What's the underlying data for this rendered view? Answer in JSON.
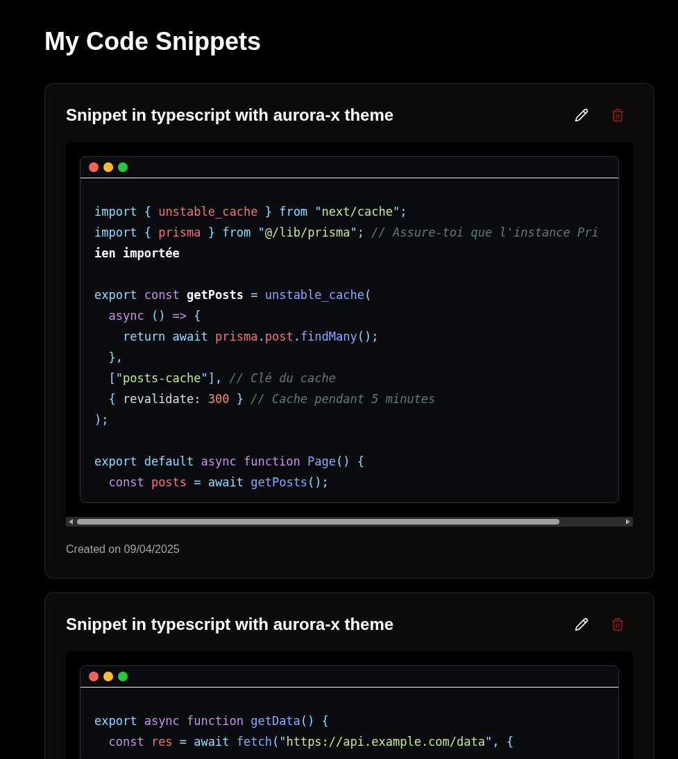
{
  "page": {
    "title": "My Code Snippets"
  },
  "snippets": [
    {
      "title": "Snippet in typescript with aurora-x theme",
      "created": "Created on 09/04/2025",
      "lines": [
        {
          "kind": "blank"
        },
        {
          "kind": "code",
          "tokens": [
            {
              "t": "import",
              "kind": "kw"
            },
            {
              "t": " { ",
              "kind": "punct"
            },
            {
              "t": "unstable_cache",
              "kind": "var"
            },
            {
              "t": " } ",
              "kind": "punct"
            },
            {
              "t": "from",
              "kind": "kw"
            },
            {
              "t": " \"",
              "kind": "punct"
            },
            {
              "t": "next/cache",
              "kind": "str"
            },
            {
              "t": "\";",
              "kind": "punct"
            }
          ]
        },
        {
          "kind": "code",
          "tokens": [
            {
              "t": "import",
              "kind": "kw"
            },
            {
              "t": " { ",
              "kind": "punct"
            },
            {
              "t": "prisma",
              "kind": "var"
            },
            {
              "t": " } ",
              "kind": "punct"
            },
            {
              "t": "from",
              "kind": "kw"
            },
            {
              "t": " \"",
              "kind": "punct"
            },
            {
              "t": "@/lib/prisma",
              "kind": "str"
            },
            {
              "t": "\"; ",
              "kind": "punct"
            },
            {
              "t": "// Assure-toi que l'instance Pri",
              "kind": "comment"
            }
          ]
        },
        {
          "kind": "code",
          "tokens": [
            {
              "t": "ien importée",
              "kind": "plain"
            }
          ]
        },
        {
          "kind": "blank"
        },
        {
          "kind": "code",
          "tokens": [
            {
              "t": "export",
              "kind": "kw"
            },
            {
              "t": " const",
              "kind": "decl"
            },
            {
              "t": " getPosts ",
              "kind": "plain"
            },
            {
              "t": "= ",
              "kind": "punct"
            },
            {
              "t": "unstable_cache",
              "kind": "fn"
            },
            {
              "t": "(",
              "kind": "punct"
            }
          ]
        },
        {
          "kind": "code",
          "tokens": [
            {
              "t": "  async",
              "kind": "decl"
            },
            {
              "t": " () ",
              "kind": "punct"
            },
            {
              "t": "=>",
              "kind": "decl"
            },
            {
              "t": " {",
              "kind": "punct"
            }
          ]
        },
        {
          "kind": "code",
          "tokens": [
            {
              "t": "    return await ",
              "kind": "kw"
            },
            {
              "t": "prisma",
              "kind": "var"
            },
            {
              "t": ".",
              "kind": "punct"
            },
            {
              "t": "post",
              "kind": "var"
            },
            {
              "t": ".",
              "kind": "punct"
            },
            {
              "t": "findMany",
              "kind": "fn"
            },
            {
              "t": "();",
              "kind": "punct"
            }
          ]
        },
        {
          "kind": "code",
          "tokens": [
            {
              "t": "  },",
              "kind": "punct"
            }
          ]
        },
        {
          "kind": "code",
          "tokens": [
            {
              "t": "  [\"",
              "kind": "punct"
            },
            {
              "t": "posts-cache",
              "kind": "str"
            },
            {
              "t": "\"], ",
              "kind": "punct"
            },
            {
              "t": "// Clé du cache",
              "kind": "comment"
            }
          ]
        },
        {
          "kind": "code",
          "tokens": [
            {
              "t": "  { ",
              "kind": "punct"
            },
            {
              "t": "revalidate: ",
              "kind": "prop"
            },
            {
              "t": "300",
              "kind": "num"
            },
            {
              "t": " } ",
              "kind": "punct"
            },
            {
              "t": "// Cache pendant 5 minutes",
              "kind": "comment"
            }
          ]
        },
        {
          "kind": "code",
          "tokens": [
            {
              "t": ");",
              "kind": "punct"
            }
          ]
        },
        {
          "kind": "blank"
        },
        {
          "kind": "code",
          "tokens": [
            {
              "t": "export default ",
              "kind": "kw"
            },
            {
              "t": "async function ",
              "kind": "decl"
            },
            {
              "t": "Page",
              "kind": "fn"
            },
            {
              "t": "() {",
              "kind": "punct"
            }
          ]
        },
        {
          "kind": "code",
          "tokens": [
            {
              "t": "  const ",
              "kind": "decl"
            },
            {
              "t": "posts",
              "kind": "var"
            },
            {
              "t": " = ",
              "kind": "punct"
            },
            {
              "t": "await ",
              "kind": "kw"
            },
            {
              "t": "getPosts",
              "kind": "fn"
            },
            {
              "t": "();",
              "kind": "punct"
            }
          ]
        }
      ]
    },
    {
      "title": "Snippet in typescript with aurora-x theme",
      "lines": [
        {
          "kind": "blank"
        },
        {
          "kind": "code",
          "tokens": [
            {
              "t": "export ",
              "kind": "kw"
            },
            {
              "t": "async function ",
              "kind": "decl"
            },
            {
              "t": "getData",
              "kind": "fn"
            },
            {
              "t": "() {",
              "kind": "punct"
            }
          ]
        },
        {
          "kind": "code",
          "tokens": [
            {
              "t": "  const ",
              "kind": "decl"
            },
            {
              "t": "res",
              "kind": "var"
            },
            {
              "t": " = ",
              "kind": "punct"
            },
            {
              "t": "await ",
              "kind": "kw"
            },
            {
              "t": "fetch",
              "kind": "fn"
            },
            {
              "t": "(\"",
              "kind": "punct"
            },
            {
              "t": "https://api.example.com/data",
              "kind": "str"
            },
            {
              "t": "\", {",
              "kind": "punct"
            }
          ]
        }
      ]
    }
  ]
}
